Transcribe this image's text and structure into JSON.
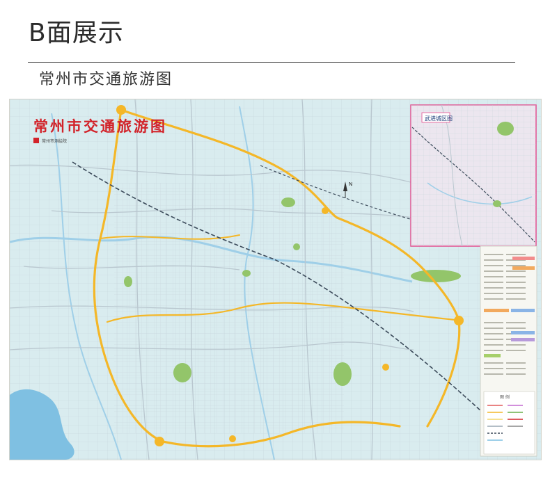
{
  "page": {
    "heading": "B面展示",
    "subheading": "常州市交通旅游图"
  },
  "map": {
    "title": "常州市交通旅游图",
    "publisher": "常州市测绘院",
    "compass_label": "N",
    "inset_title": "武进城区图",
    "legend_title": "图 例",
    "colors": {
      "base": "#d9ecef",
      "land": "#e8f1e6",
      "road_major": "#f4b728",
      "road_minor": "#b9c7cf",
      "water": "#9fcfe8",
      "lake": "#7fc0e2",
      "green": "#93c56a",
      "rail": "#3b4a5a",
      "title_red": "#d2232a",
      "inset_border": "#e24f8f"
    }
  }
}
